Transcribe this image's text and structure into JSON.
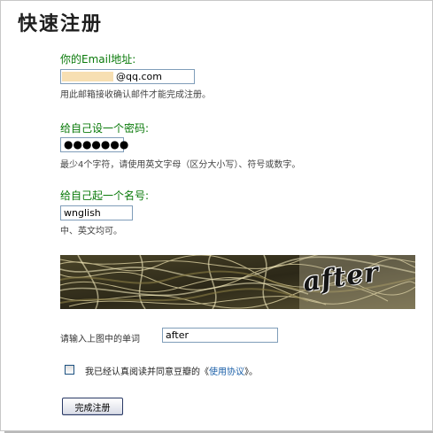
{
  "page": {
    "title": "快速注册"
  },
  "email": {
    "label": "你的Email地址:",
    "value_domain": "@qq.com",
    "hint": "用此邮箱接收确认邮件才能完成注册。"
  },
  "password": {
    "label": "给自己设一个密码:",
    "value": "●●●●●●●",
    "hint": "最少4个字符，请使用英文字母（区分大小写）、符号或数字。"
  },
  "nickname": {
    "label": "给自己起一个名号:",
    "value": "wnglish",
    "hint": "中、英文均可。"
  },
  "captcha": {
    "image_word": "after",
    "label": "请输入上图中的单词",
    "value": "after"
  },
  "agreement": {
    "prefix": "我已经认真阅读并同意豆瓣的《",
    "link": "使用协议",
    "suffix": "》。",
    "checked": false
  },
  "submit": {
    "label": "完成注册"
  },
  "colors": {
    "label_green": "#0a7a0a",
    "link_blue": "#1a5fa8",
    "input_border": "#7f9db9"
  }
}
